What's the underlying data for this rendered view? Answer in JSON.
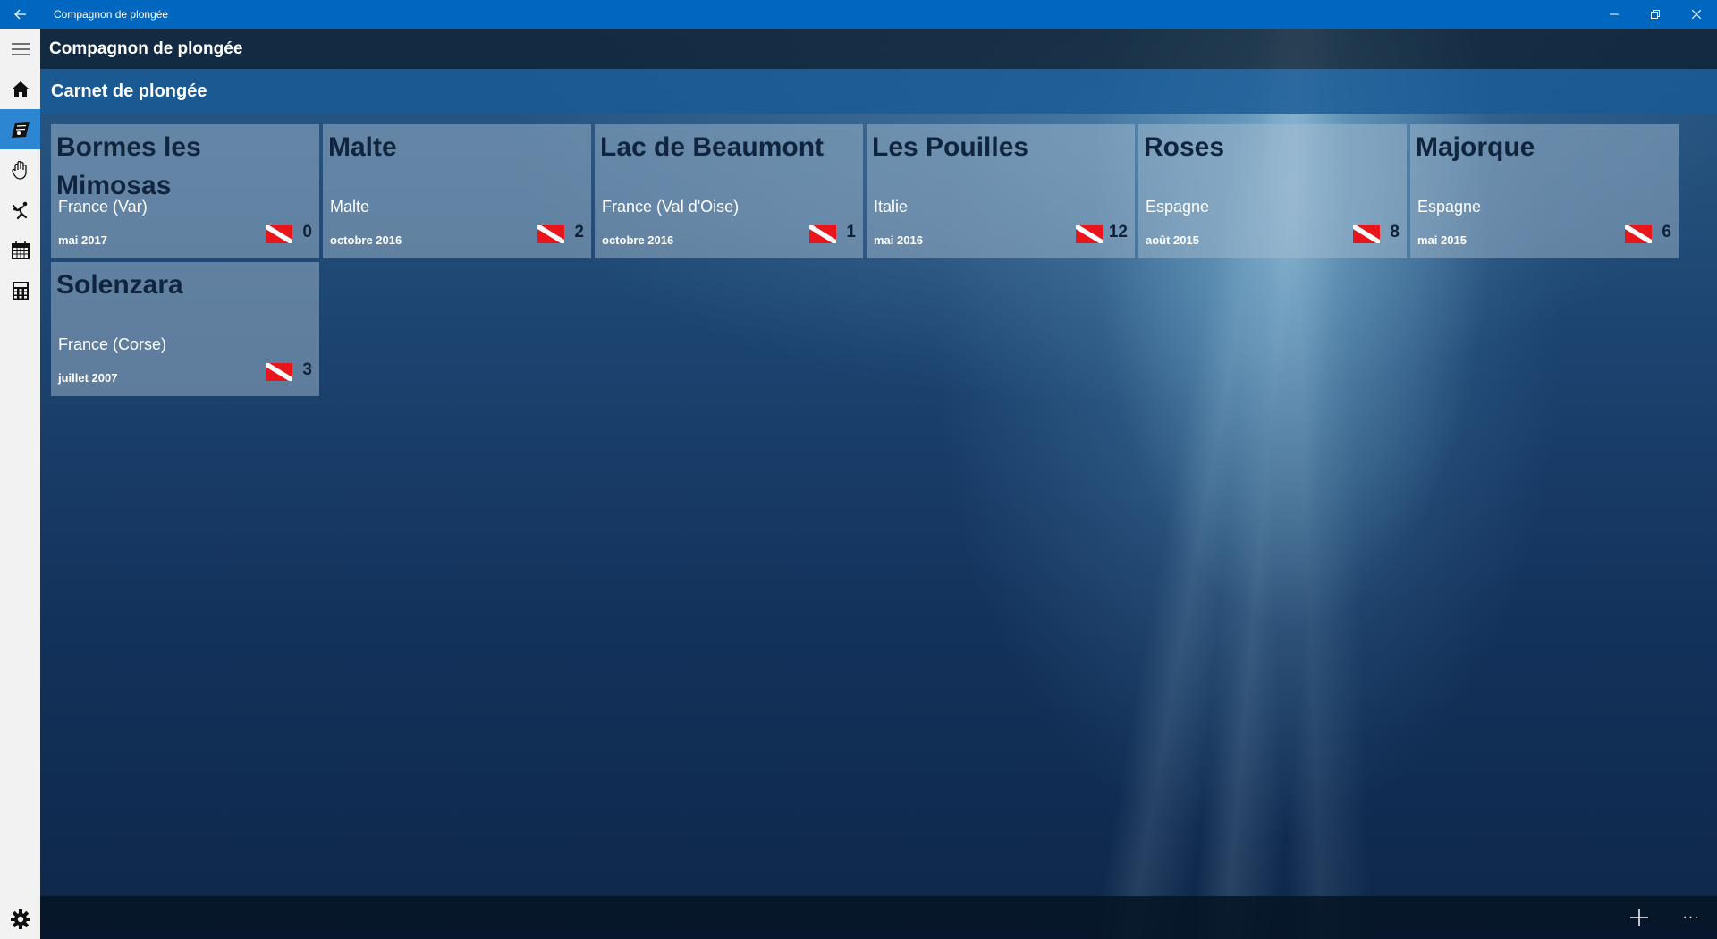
{
  "window": {
    "title": "Compagnon de plongée",
    "icons": {
      "back": "back-arrow-icon",
      "minimize": "minimize-icon",
      "restore": "restore-icon",
      "close": "close-icon"
    }
  },
  "nav": {
    "items": [
      {
        "id": "menu",
        "icon": "hamburger-icon"
      },
      {
        "id": "home",
        "icon": "home-icon"
      },
      {
        "id": "logbook",
        "icon": "logbook-icon",
        "active": true
      },
      {
        "id": "hand-signals",
        "icon": "hand-signal-icon"
      },
      {
        "id": "diver",
        "icon": "diver-icon"
      },
      {
        "id": "calendar",
        "icon": "calendar-icon"
      },
      {
        "id": "calculator",
        "icon": "calculator-icon"
      }
    ],
    "settings_icon": "gear-icon",
    "active_color": "#2d86d2"
  },
  "appbar": {
    "title": "Compagnon de plongée"
  },
  "page": {
    "title": "Carnet de plongée"
  },
  "trips": [
    {
      "name": "Bormes les Mimosas",
      "country": "France (Var)",
      "date": "mai 2017",
      "dives": "0"
    },
    {
      "name": "Malte",
      "country": "Malte",
      "date": "octobre 2016",
      "dives": "2"
    },
    {
      "name": "Lac de Beaumont",
      "country": "France (Val d'Oise)",
      "date": "octobre 2016",
      "dives": "1"
    },
    {
      "name": "Les Pouilles",
      "country": "Italie",
      "date": "mai 2016",
      "dives": "12"
    },
    {
      "name": "Roses",
      "country": "Espagne",
      "date": "août 2015",
      "dives": "8"
    },
    {
      "name": "Majorque",
      "country": "Espagne",
      "date": "mai 2015",
      "dives": "6"
    },
    {
      "name": "Solenzara",
      "country": "France (Corse)",
      "date": "juillet 2007",
      "dives": "3"
    }
  ],
  "cmdbar": {
    "add_icon": "plus-icon",
    "more_icon": "more-ellipsis-icon",
    "more_label": "···"
  },
  "colors": {
    "titlebar": "#0067c0",
    "dive_flag_red": "#e8161b",
    "dive_flag_white": "#ffffff"
  }
}
